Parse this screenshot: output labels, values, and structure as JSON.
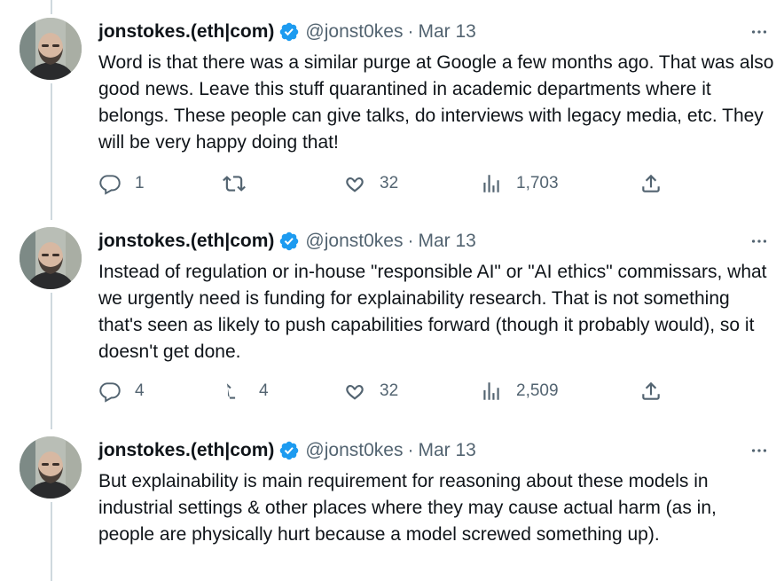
{
  "author": {
    "name": "jonstokes.(eth|com)",
    "handle": "@jonst0kes",
    "separator": "·"
  },
  "icons": {
    "verified": "verified-badge-icon",
    "more": "more-horizontal-icon",
    "reply": "reply-icon",
    "retweet": "retweet-icon",
    "like": "heart-icon",
    "views": "views-icon",
    "share": "share-icon"
  },
  "colors": {
    "verified": "#1d9bf0",
    "secondary_text": "#536471",
    "thread_line": "#cfd9de"
  },
  "tweets": [
    {
      "date": "Mar 13",
      "text": "Word is that there was a similar purge at Google a few months ago. That was also good news. Leave this stuff quarantined in academic departments where it belongs. These people can give talks, do interviews with legacy media, etc. They will be very happy doing that!",
      "replies": "1",
      "retweets": "",
      "likes": "32",
      "views": "1,703"
    },
    {
      "date": "Mar 13",
      "text": "Instead of regulation or in-house \"responsible AI\" or \"AI ethics\" commissars, what we urgently need is funding for explainability research. That is not something that's seen as likely to push capabilities forward (though it probably would), so it doesn't get done.",
      "replies": "4",
      "retweets": "4",
      "likes": "32",
      "views": "2,509"
    },
    {
      "date": "Mar 13",
      "text": "But explainability is main requirement for reasoning about these models in industrial settings & other places where they may cause actual harm (as in, people are physically hurt because a model screwed something up).",
      "replies": "",
      "retweets": "",
      "likes": "",
      "views": ""
    }
  ]
}
